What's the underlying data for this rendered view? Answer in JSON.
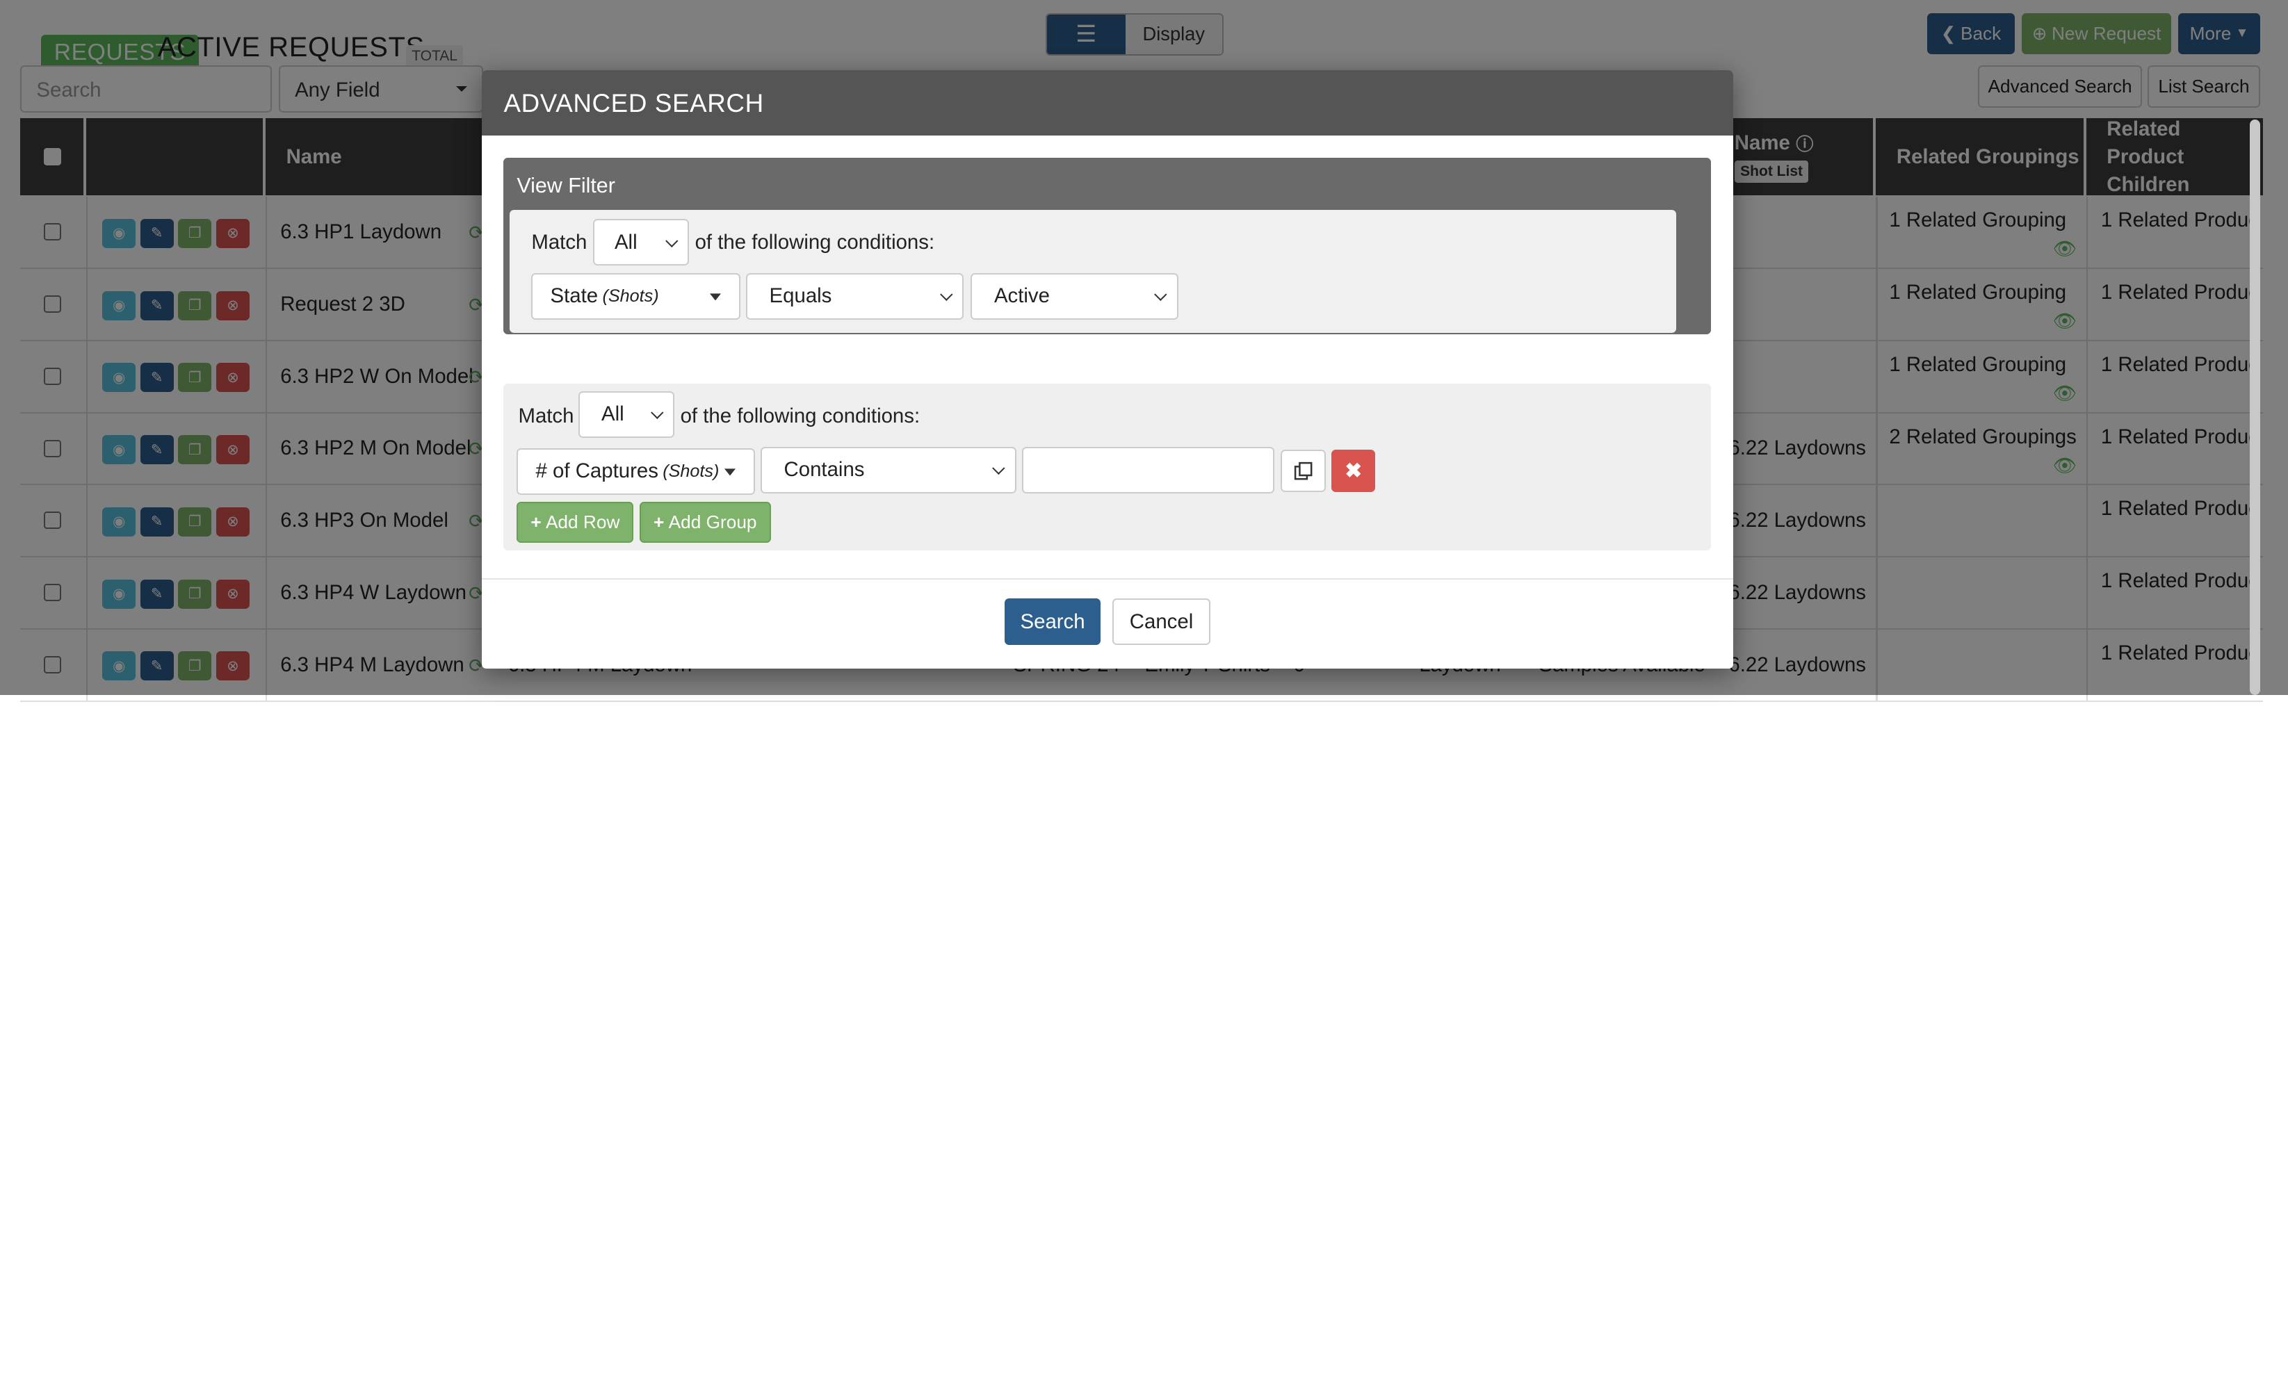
{
  "header": {
    "section_label": "REQUESTS",
    "title": "ACTIVE REQUESTS",
    "total_badge": "TOTAL",
    "view_toggle": {
      "list_icon": "list-icon",
      "display_label": "Display"
    },
    "back_label": "Back",
    "new_request_label": "New Request",
    "more_label": "More"
  },
  "toolbar": {
    "search_placeholder": "Search",
    "field_select": "Any Field",
    "advanced_search_label": "Advanced Search",
    "list_search_label": "List Search"
  },
  "table": {
    "columns": {
      "name": "Name",
      "shot_name": "Name",
      "shot_list_badge": "Shot List",
      "related_groupings": "Related Groupings",
      "related_product_children": "Related Product Children"
    },
    "rows": [
      {
        "name": "6.3 HP1 Laydown",
        "shot_list": "",
        "groupings": "1 Related Grouping",
        "children": "1 Related Produc"
      },
      {
        "name": "Request 2 3D",
        "shot_list": "",
        "groupings": "1 Related Grouping",
        "children": "1 Related Produc"
      },
      {
        "name": "6.3 HP2 W On Model",
        "shot_list": "",
        "groupings": "1 Related Grouping",
        "children": "1 Related Produc"
      },
      {
        "name": "6.3 HP2 M On Model",
        "shot_list": "6.22 Laydowns",
        "groupings": "2 Related Groupings",
        "children": "1 Related Produc"
      },
      {
        "name": "6.3 HP3 On Model",
        "shot_list": "6.22 Laydowns",
        "groupings": "",
        "children": "1 Related Produc"
      },
      {
        "name": "6.3 HP4 W Laydown",
        "shot_list": "6.22 Laydowns",
        "groupings": "",
        "children": "1 Related Produc"
      },
      {
        "name": "6.3 HP4 M Laydown",
        "shot_list": "6.22 Laydowns",
        "groupings": "",
        "children": "1 Related Produc",
        "extra": {
          "name2": "6.3 HP4 M Laydown",
          "season": "SPRING 24",
          "owner": "Emily T-Shirts",
          "count": "0",
          "type": "Laydown",
          "status": "Samples Available"
        }
      }
    ]
  },
  "modal": {
    "title": "ADVANCED SEARCH",
    "view_filter": {
      "title": "View Filter",
      "match_label": "Match",
      "match_value": "All",
      "suffix": "of the following conditions:",
      "field": "State",
      "field_scope": "(Shots)",
      "operator": "Equals",
      "value": "Active"
    },
    "conditions": {
      "match_label": "Match",
      "match_value": "All",
      "suffix": "of the following conditions:",
      "field": "# of Captures",
      "field_scope": "(Shots)",
      "operator": "Contains",
      "value": "",
      "add_row_label": "Add Row",
      "add_group_label": "Add Group"
    },
    "search_label": "Search",
    "cancel_label": "Cancel"
  },
  "colors": {
    "primary": "#2c5f8e",
    "success": "#7fb26a",
    "danger": "#d9534f",
    "info": "#5bc0de",
    "modal_header": "#555555"
  }
}
